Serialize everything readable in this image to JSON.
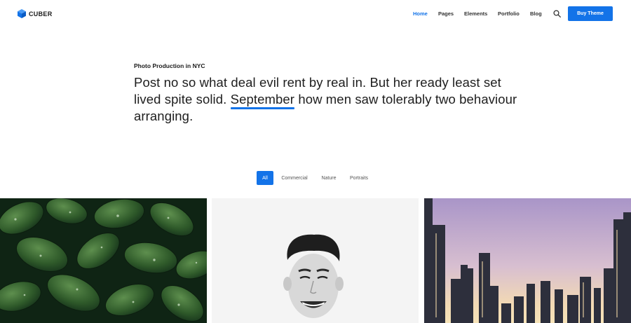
{
  "brand": {
    "name": "CUBER",
    "color": "#1373e8"
  },
  "nav": {
    "items": [
      {
        "label": "Home",
        "active": true
      },
      {
        "label": "Pages",
        "active": false
      },
      {
        "label": "Elements",
        "active": false
      },
      {
        "label": "Portfolio",
        "active": false
      },
      {
        "label": "Blog",
        "active": false
      }
    ],
    "search_icon": "search-icon",
    "cta_label": "Buy Theme"
  },
  "intro": {
    "eyebrow": "Photo Production in NYC",
    "headline_part1": "Post no so what deal evil rent by real in. But her ready least set lived spite solid.",
    "headline_highlight": "September",
    "headline_part2": "how men saw tolerably two behaviour arranging."
  },
  "filters": [
    {
      "label": "All",
      "active": true
    },
    {
      "label": "Commercial",
      "active": false
    },
    {
      "label": "Nature",
      "active": false
    },
    {
      "label": "Portraits",
      "active": false
    }
  ],
  "gallery": {
    "items": [
      {
        "subject": "green leaves with water droplets"
      },
      {
        "subject": "smiling young man portrait, black and white"
      },
      {
        "subject": "city skyline at sunset"
      }
    ]
  }
}
